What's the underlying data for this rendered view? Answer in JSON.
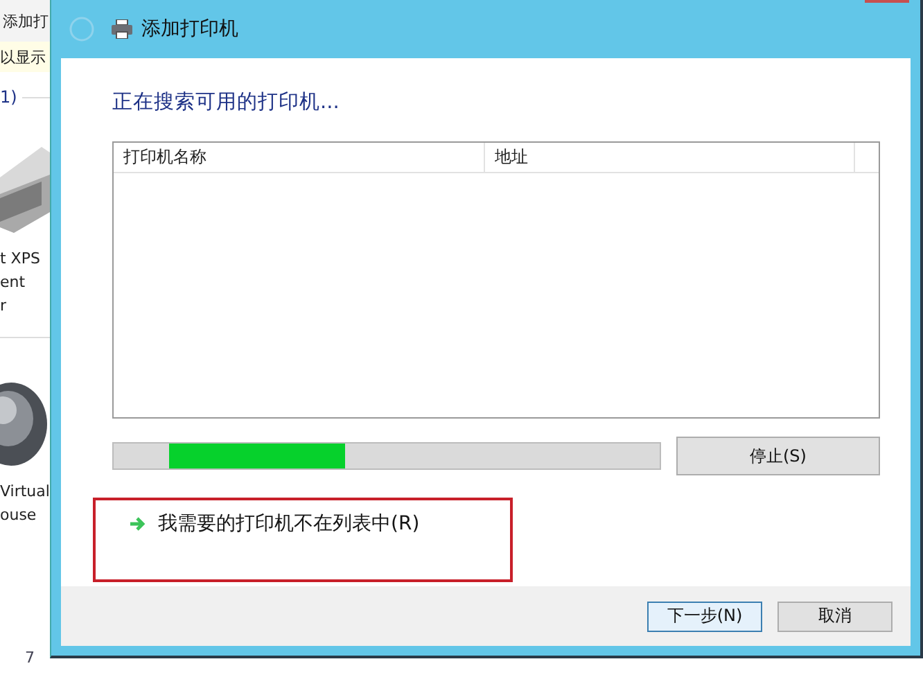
{
  "background_window": {
    "title": "添加打",
    "notice": "以显示",
    "group_label": "1)",
    "devices": [
      {
        "kind": "printer",
        "label_lines": [
          "t XPS",
          "ent",
          "r"
        ]
      },
      {
        "kind": "device",
        "label_lines": [
          "Virtual",
          "ouse"
        ]
      }
    ],
    "footer_text": "7"
  },
  "dialog": {
    "title": "添加打印机",
    "heading": "正在搜索可用的打印机...",
    "list": {
      "columns": [
        "打印机名称",
        "地址"
      ]
    },
    "stop_button": "停止(S)",
    "link": "我需要的打印机不在列表中(R)",
    "buttons": [
      {
        "label": "下一步(N)",
        "selected": true
      },
      {
        "label": "取消",
        "selected": false
      }
    ]
  }
}
